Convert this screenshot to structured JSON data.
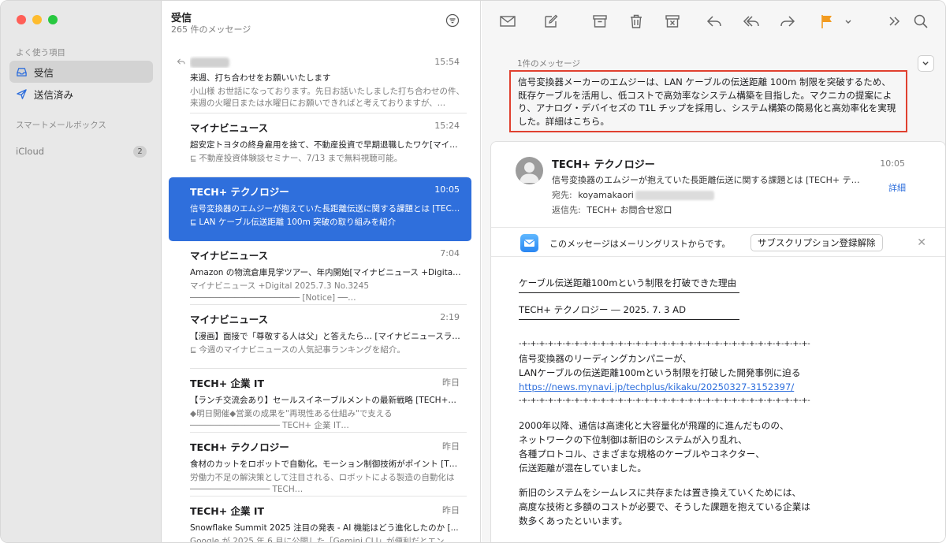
{
  "sidebar": {
    "favorites_label": "よく使う項目",
    "items": [
      {
        "label": "受信",
        "icon": "inbox-icon"
      },
      {
        "label": "送信済み",
        "icon": "paperplane-icon"
      }
    ],
    "smart_label": "スマートメールボックス",
    "account": {
      "label": "iCloud",
      "badge": "2"
    }
  },
  "list": {
    "title": "受信",
    "count": "265 件のメッセージ",
    "messages": [
      {
        "from": "",
        "time": "15:54",
        "subject": "来週、打ち合わせをお願いいたします",
        "preview": "小山様 お世話になっております。先日お話いたしました打ち合わせの件、来週の火曜日または水曜日にお願いできればと考えておりますが、…",
        "replied": true,
        "sender_blurred": true
      },
      {
        "from": "マイナビニュース",
        "time": "15:24",
        "subject": "超安定トヨタの終身雇用を捨て、不動産投資で早期退職したワケ[マイ…",
        "preview": "不動産投資体験談セミナー、7/13 まで無料視聴可能。",
        "preview_icon": true
      },
      {
        "from": "TECH+ テクノロジー",
        "time": "10:05",
        "subject": "信号変換器のエムジーが抱えていた長距離伝送に関する課題とは [TEC…",
        "preview": "LAN ケーブル伝送距離 100m 突破の取り組みを紹介",
        "preview_icon": true,
        "selected": true
      },
      {
        "from": "マイナビニュース",
        "time": "7:04",
        "subject": "Amazon の物流倉庫見学ツアー、年内開始[マイナビニュース +Digita…",
        "preview": "マイナビニュース +Digital 2025.7.3 No.3245 ────────────────────── [Notice] ──…"
      },
      {
        "from": "マイナビニュース",
        "time": "2:19",
        "subject": "【漫画】面接で「尊敬する人は父」と答えたら… [マイナビニュースライ…",
        "preview": "今週のマイナビニュースの人気記事ランキングを紹介。",
        "preview_icon": true
      },
      {
        "from": "TECH+ 企業 IT",
        "time": "昨日",
        "subject": "【ランチ交流会あり】セールスイネーブルメントの最新戦略 [TECH+…",
        "preview": "◆明日開催◆営業の成果を\"再現性ある仕組み\"で支える ────────────────── TECH+ 企業 IT…"
      },
      {
        "from": "TECH+ テクノロジー",
        "time": "昨日",
        "subject": "食材のカットをロボットで自動化。モーション制御技術がポイント [T…",
        "preview": "労働力不足の解決策として注目される、ロボットによる製造の自動化は ──────────────── TECH…"
      },
      {
        "from": "TECH+ 企業 IT",
        "time": "昨日",
        "subject": "Snowflake Summit 2025 注目の発表 - AI 機能はどう進化したのか [...",
        "preview": "Google が 2025 年 6 月に公開した「Gemini CLI」が便利だとエン"
      }
    ]
  },
  "viewer": {
    "thread_count": "1件のメッセージ",
    "summary": "信号変換器メーカーのエムジーは、LAN ケーブルの伝送距離 100m 制限を突破するため、既存ケーブルを活用し、低コストで高効率なシステム構築を目指した。マクニカの提案により、アナログ・デバイセズの T1L チップを採用し、システム構築の簡易化と高効率化を実現した。詳細はこちら。",
    "mail": {
      "sender": "TECH+ テクノロジー",
      "time": "10:05",
      "subject": "信号変換器のエムジーが抱えていた長距離伝送に関する課題とは [TECH+ テ…",
      "to_label": "宛先:",
      "to_value": "koyamakaori",
      "reply_label": "返信先:",
      "reply_value": "TECH+ お問合せ窓口",
      "details": "詳細"
    },
    "notice": {
      "text": "このメッセージはメーリングリストからです。",
      "button": "サブスクリプション登録解除"
    },
    "body": {
      "heading1": "ケーブル伝送距離100mという制限を打破できた理由",
      "heading2": "TECH+ テクノロジー ― 2025. 7. 3 AD",
      "plus_line": "-+-+-+-+-+-+-+-+-+-+-+-+-+-+-+-+-+-+-+-+-+-+-+-+-+-+-+-+-+-+-+-+-+-+-+-+-+-+-+-+",
      "intro1": "信号変換器のリーディングカンパニーが、",
      "intro2": "LANケーブルの伝送距離100mという制限を打破した開発事例に迫る",
      "url": "https://news.mynavi.jp/techplus/kikaku/20250327-3152397/",
      "para1": [
        "2000年以降、通信は高速化と大容量化が飛躍的に進んだものの、",
        "ネットワークの下位制御は新旧のシステムが入り乱れ、",
        "各種プロトコル、さまざまな規格のケーブルやコネクター、",
        "伝送距離が混在していました。"
      ],
      "para2": [
        "新旧のシステムをシームレスに共存または置き換えていくためには、",
        "高度な技術と多額のコストが必要で、そうした課題を抱えている企業は",
        "数多くあったといいます。"
      ]
    }
  },
  "colors": {
    "accent": "#2f6fdc",
    "highlight_border": "#e0402f",
    "flag": "#f29b20"
  }
}
